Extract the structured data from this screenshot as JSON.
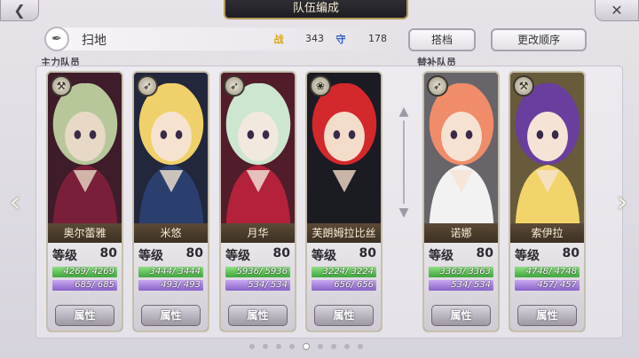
{
  "header": {
    "title": "队伍编成"
  },
  "team": {
    "name": "扫地",
    "atk_icon": "战",
    "atk_value": "343",
    "def_icon": "守",
    "def_value": "178"
  },
  "buttons": {
    "partner": "搭档",
    "change_order": "更改顺序"
  },
  "sections": {
    "main": "主力队员",
    "sub": "替补队员"
  },
  "labels": {
    "level": "等级",
    "attribute": "属性"
  },
  "units": [
    {
      "name": "奥尔蕾雅",
      "level": "80",
      "hp": "4269/ 4269",
      "sp": "685/ 685",
      "hp_frac": 1,
      "sp_frac": 1,
      "weapon": "axe-icon",
      "palette": [
        "#b7c79a",
        "#7a1f3a",
        "#e8d9c6"
      ]
    },
    {
      "name": "米悠",
      "level": "80",
      "hp": "3444/ 3444",
      "sp": "493/ 493",
      "hp_frac": 1,
      "sp_frac": 1,
      "weapon": "bow-icon",
      "palette": [
        "#f0d06a",
        "#2b3f6e",
        "#f5e3cf"
      ]
    },
    {
      "name": "月华",
      "level": "80",
      "hp": "5936/ 5936",
      "sp": "534/ 534",
      "hp_frac": 1,
      "sp_frac": 1,
      "weapon": "bow-icon",
      "palette": [
        "#cde6cf",
        "#b3213a",
        "#f1e8de"
      ]
    },
    {
      "name": "芙朗姆拉比丝",
      "level": "80",
      "hp": "3224/ 3224",
      "sp": "656/ 656",
      "hp_frac": 1,
      "sp_frac": 1,
      "weapon": "magic-icon",
      "palette": [
        "#d3282c",
        "#1b1b22",
        "#f4dccb"
      ]
    },
    {
      "name": "诺娜",
      "level": "80",
      "hp": "3363/ 3363",
      "sp": "534/ 534",
      "hp_frac": 1,
      "sp_frac": 1,
      "weapon": "bow-icon",
      "palette": [
        "#f08c6a",
        "#f2f2f2",
        "#f6e2d2"
      ]
    },
    {
      "name": "索伊拉",
      "level": "80",
      "hp": "4748/ 4748",
      "sp": "457/ 457",
      "hp_frac": 1,
      "sp_frac": 1,
      "weapon": "axe-icon",
      "palette": [
        "#6a3e9e",
        "#f3d46b",
        "#f5e4d6"
      ]
    }
  ],
  "pagination": {
    "count": 9,
    "active_index": 4
  }
}
